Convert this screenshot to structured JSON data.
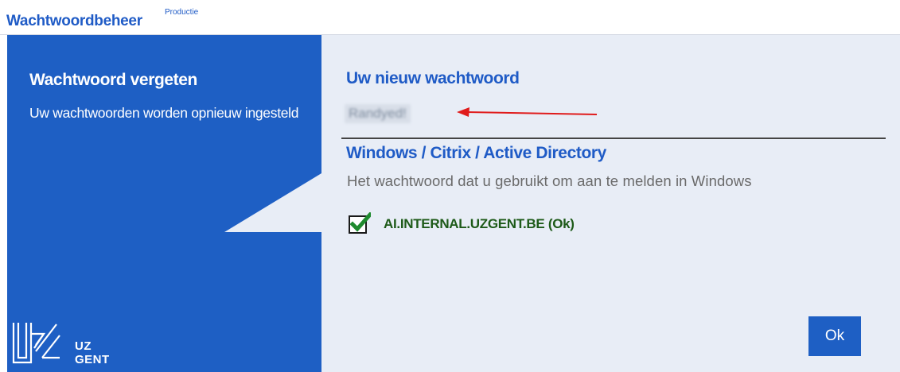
{
  "app": {
    "title": "Wachtwoordbeheer",
    "environment": "Productie"
  },
  "left_panel": {
    "title": "Wachtwoord vergeten",
    "subtitle": "Uw wachtwoorden worden opnieuw ingesteld",
    "logo": {
      "icon": "uz-gent-logo-icon",
      "line1": "UZ",
      "line2": "GENT"
    }
  },
  "new_password": {
    "heading": "Uw nieuw wachtwoord",
    "value": "Randyed!",
    "obscured": true,
    "annotation": "red-arrow-icon"
  },
  "windows_account": {
    "heading": "Windows / Citrix / Active Directory",
    "description": "Het wachtwoord dat u gebruikt om aan te melden in Windows",
    "domains": [
      {
        "checked": true,
        "label": "AI.INTERNAL.UZGENT.BE  (Ok)"
      }
    ]
  },
  "actions": {
    "ok_label": "Ok"
  },
  "colors": {
    "brand_blue": "#1e5fc4",
    "panel_background": "#e8edf6",
    "success_green": "#1d5a18",
    "annotation_red": "#e01b1b"
  }
}
